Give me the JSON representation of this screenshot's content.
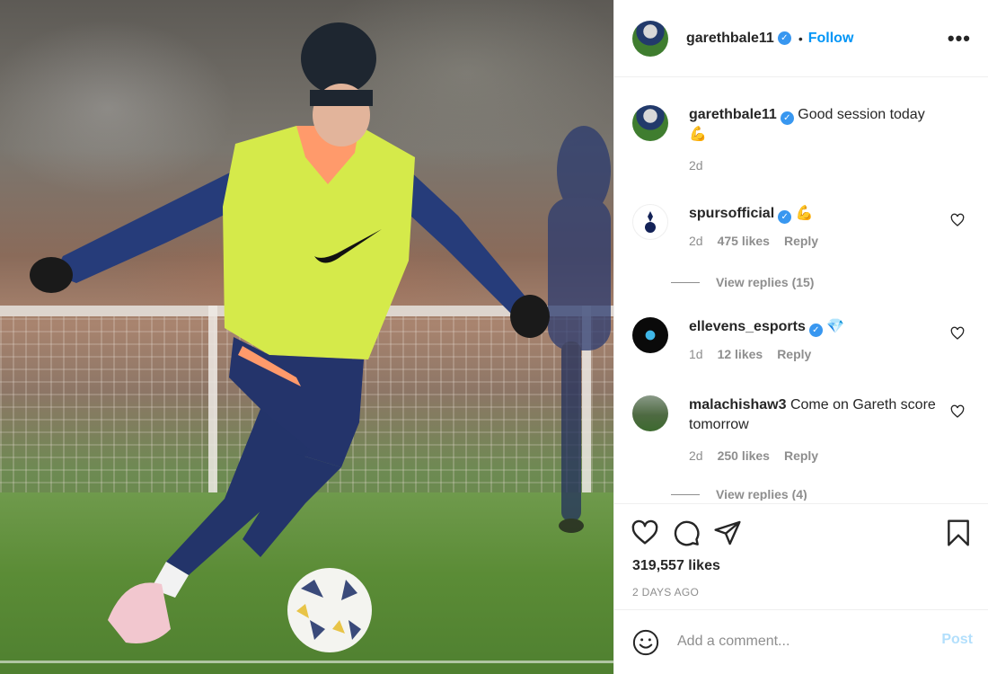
{
  "header": {
    "username": "garethbale11",
    "dot": "•",
    "follow_label": "Follow",
    "more_label": "•••"
  },
  "caption": {
    "username": "garethbale11",
    "text": "Good session today",
    "emoji": "💪",
    "time": "2d"
  },
  "comments": [
    {
      "username": "spursofficial",
      "text": "💪",
      "time": "2d",
      "likes": "475 likes",
      "reply": "Reply",
      "view_replies": "View replies (15)"
    },
    {
      "username": "ellevens_esports",
      "text": "💎",
      "time": "1d",
      "likes": "12 likes",
      "reply": "Reply"
    },
    {
      "username": "malachishaw3",
      "text": "Come on Gareth score tomorrow",
      "time": "2d",
      "likes": "250 likes",
      "reply": "Reply",
      "view_replies": "View replies (4)"
    }
  ],
  "stats": {
    "likes": "319,557 likes",
    "ago": "2 DAYS AGO"
  },
  "composer": {
    "placeholder": "Add a comment...",
    "post_label": "Post"
  },
  "colors": {
    "accent": "#0095f6",
    "verified": "#3897f0",
    "muted": "#8e8e8e",
    "post_disabled": "#b2dffc"
  },
  "icons": [
    "verified-badge-icon",
    "more-options-icon",
    "heart-icon",
    "comment-icon",
    "share-icon",
    "bookmark-icon",
    "emoji-icon"
  ]
}
